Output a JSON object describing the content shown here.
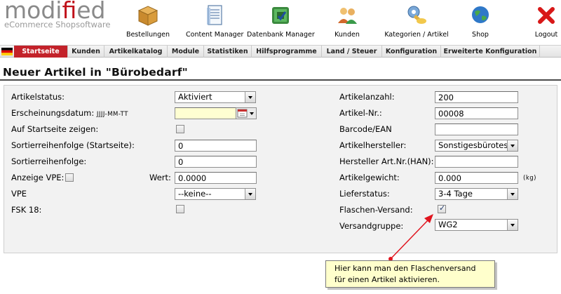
{
  "logo": {
    "brand_part1": "modi",
    "brand_part2": "fi",
    "brand_part3": "ed",
    "tagline": "eCommerce Shopsoftware"
  },
  "topnav": [
    {
      "label": "Bestellungen",
      "icon": "box-icon"
    },
    {
      "label": "Content Manager",
      "icon": "document-icon"
    },
    {
      "label": "Datenbank Manager",
      "icon": "database-icon"
    },
    {
      "label": "Kunden",
      "icon": "users-icon"
    },
    {
      "label": "Kategorien / Artikel",
      "icon": "key-icon"
    },
    {
      "label": "Shop",
      "icon": "globe-icon"
    },
    {
      "label": "Logout",
      "icon": "close-icon"
    }
  ],
  "tabs": [
    "Startseite",
    "Kunden",
    "Artikelkatalog",
    "Module",
    "Statistiken",
    "Hilfsprogramme",
    "Land / Steuer",
    "Konfiguration",
    "Erweiterte Konfiguration"
  ],
  "page": {
    "title": "Neuer Artikel in \"Bürobedarf\""
  },
  "form": {
    "artikelstatus_label": "Artikelstatus:",
    "artikelstatus_value": "Aktiviert",
    "erscheinungsdatum_label": "Erscheinungsdatum:",
    "erscheinungsdatum_hint": "JJJJ-MM-TT",
    "erscheinungsdatum_value": "",
    "startseite_zeigen_label": "Auf Startseite zeigen:",
    "sortierreihenfolge_startseite_label": "Sortierreihenfolge (Startseite):",
    "sortierreihenfolge_startseite_value": "0",
    "sortierreihenfolge_label": "Sortierreihenfolge:",
    "sortierreihenfolge_value": "0",
    "anzeige_vpe_label": "Anzeige VPE:",
    "wert_label": "Wert:",
    "wert_value": "0.0000",
    "vpe_label": "VPE",
    "vpe_value": "--keine--",
    "fsk_label": "FSK 18:",
    "artikelanzahl_label": "Artikelanzahl:",
    "artikelanzahl_value": "200",
    "artikelnr_label": "Artikel-Nr.:",
    "artikelnr_value": "00008",
    "barcode_label": "Barcode/EAN",
    "barcode_value": "",
    "hersteller_label": "Artikelhersteller:",
    "hersteller_value": "Sonstigesbürotes",
    "hersteller_artnr_label": "Hersteller Art.Nr.(HAN):",
    "hersteller_artnr_value": "",
    "gewicht_label": "Artikelgewicht:",
    "gewicht_value": "0.000",
    "gewicht_unit": "(kg)",
    "lieferstatus_label": "Lieferstatus:",
    "lieferstatus_value": "3-4 Tage",
    "flaschen_label": "Flaschen-Versand:",
    "versandgruppe_label": "Versandgruppe:",
    "versandgruppe_value": "WG2"
  },
  "tooltip": {
    "line1": "Hier kann man den Flaschenversand",
    "line2": "für einen Artikel aktivieren."
  },
  "colors": {
    "tab_active": "#c3222a",
    "logo_red": "#c0111a",
    "tooltip_bg": "#ffffcc",
    "arrow": "#e0141e"
  }
}
